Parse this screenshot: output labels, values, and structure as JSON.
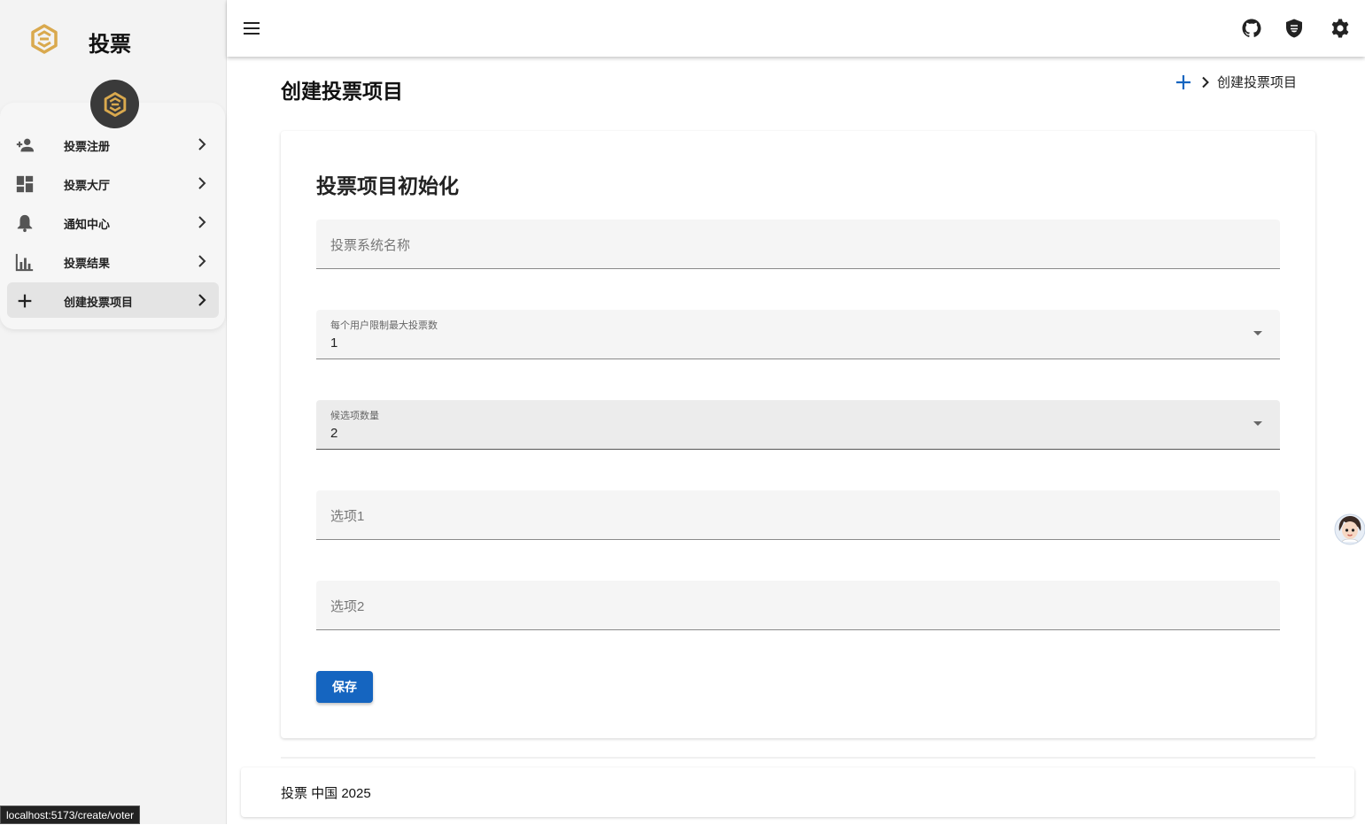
{
  "brand": {
    "title": "投票"
  },
  "sidebar": {
    "items": [
      {
        "label": "投票注册",
        "icon": "person-add-icon",
        "active": false
      },
      {
        "label": "投票大厅",
        "icon": "dashboard-icon",
        "active": false
      },
      {
        "label": "通知中心",
        "icon": "bell-icon",
        "active": false
      },
      {
        "label": "投票结果",
        "icon": "bar-chart-icon",
        "active": false
      },
      {
        "label": "创建投票项目",
        "icon": "plus-icon",
        "active": true
      }
    ]
  },
  "topbar": {
    "icons": [
      "menu-icon",
      "github-icon",
      "shield-icon",
      "gear-icon"
    ]
  },
  "page": {
    "title": "创建投票项目"
  },
  "breadcrumb": {
    "current": "创建投票项目"
  },
  "form": {
    "title": "投票项目初始化",
    "system_name": {
      "placeholder": "投票系统名称"
    },
    "max_votes": {
      "label": "每个用户限制最大投票数",
      "value": "1"
    },
    "option_count": {
      "label": "候选项数量",
      "value": "2"
    },
    "option1": {
      "placeholder": "选项1"
    },
    "option2": {
      "placeholder": "选项2"
    },
    "save_label": "保存"
  },
  "footer": {
    "text": "投票 中国 2025"
  },
  "status": {
    "url": "localhost:5173/create/voter"
  },
  "colors": {
    "primary": "#1565c0",
    "brand_gold": "#d9a94e",
    "sidebar_bg": "#f3f3f3"
  }
}
